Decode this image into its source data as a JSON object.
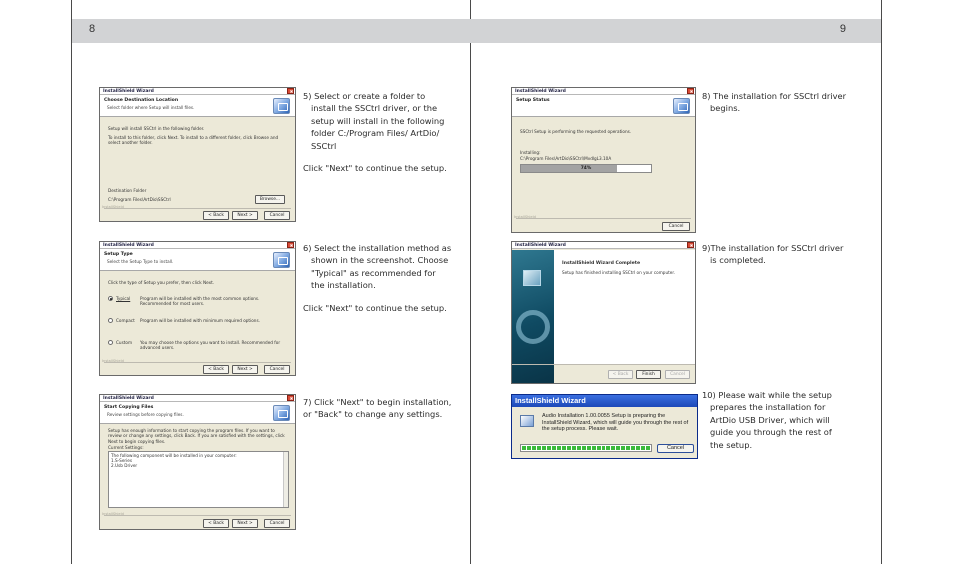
{
  "pages": {
    "left_number": "8",
    "right_number": "9"
  },
  "dialogs": {
    "title": "InstallShield Wizard",
    "dest": {
      "heading": "Choose Destination Location",
      "subheading": "Select folder where Setup will install files.",
      "line1": "Setup will install SSCtrl in the following folder.",
      "line2": "To install to this folder, click Next. To install to a different folder, click Browse and select another folder.",
      "group_label": "Destination Folder",
      "path": "C:\\Program Files\\ArtDio\\SSCtrl",
      "browse": "Browse...",
      "ghost": "InstallShield",
      "back": "< Back",
      "next": "Next >",
      "cancel": "Cancel"
    },
    "type": {
      "heading": "Setup Type",
      "subheading": "Select the Setup Type to install.",
      "prompt": "Click the type of Setup you prefer, then click Next.",
      "options": [
        {
          "label": "Typical",
          "desc": "Program will be installed with the most common options. Recommended for most users."
        },
        {
          "label": "Compact",
          "desc": "Program will be installed with minimum required options."
        },
        {
          "label": "Custom",
          "desc": "You may choose the options you want to install. Recommended for advanced users."
        }
      ],
      "ghost": "InstallShield",
      "back": "< Back",
      "next": "Next >",
      "cancel": "Cancel"
    },
    "copy": {
      "heading": "Start Copying Files",
      "subheading": "Review settings before copying files.",
      "line1": "Setup has enough information to start copying the program files. If you want to review or change any settings, click Back. If you are satisfied with the settings, click Next to begin copying files.",
      "settings_label": "Current Settings:",
      "settings": [
        "The following component will be installed in your computer:",
        "1.S-Series",
        "2.Usb Driver"
      ],
      "ghost": "InstallShield",
      "back": "< Back",
      "next": "Next >",
      "cancel": "Cancel"
    },
    "status": {
      "heading": "Setup Status",
      "line1": "SSCtrl Setup is performing the requested operations.",
      "installing": "Installing:",
      "file": "C:\\Program Files\\ArtDio\\SSCtrl\\MvdlgL3.10A",
      "progress": 0.74,
      "progress_label": "74%",
      "ghost": "InstallShield",
      "cancel": "Cancel"
    },
    "complete": {
      "heading": "InstallShield Wizard Complete",
      "line1": "Setup has finished installing SSCtrl on your computer.",
      "back": "< Back",
      "finish": "Finish",
      "cancel": "Cancel"
    },
    "prepare": {
      "title": "InstallShield Wizard",
      "text": "Audio Installation 1.00.0055 Setup is preparing the InstallShield Wizard, which will guide you through the rest of the setup process. Please wait.",
      "cancel": "Cancel",
      "progress": 1.0
    }
  },
  "steps": {
    "s5": [
      "5) Select or create a folder to",
      "install the SSCtrl driver, or the",
      "setup will install in the following",
      "folder C:/Program Files/ ArtDio/",
      "SSCtrl"
    ],
    "s5_note": "Click \"Next\" to continue the setup.",
    "s6": [
      "6) Select the installation method as",
      "shown in the screenshot. Choose",
      "\"Typical\" as recommended for",
      "the installation."
    ],
    "s6_note": "Click \"Next\" to continue the setup.",
    "s7": [
      "7) Click \"Next\" to begin installation,",
      "or \"Back\" to change any settings."
    ],
    "s8": [
      "8) The installation for SSCtrl driver",
      "begins."
    ],
    "s9": [
      "9)The installation for SSCtrl driver",
      "is completed."
    ],
    "s10": [
      "10) Please wait while the setup",
      "prepares the installation for",
      "ArtDio USB Driver, which will",
      "guide you through the rest of",
      "the setup."
    ]
  }
}
